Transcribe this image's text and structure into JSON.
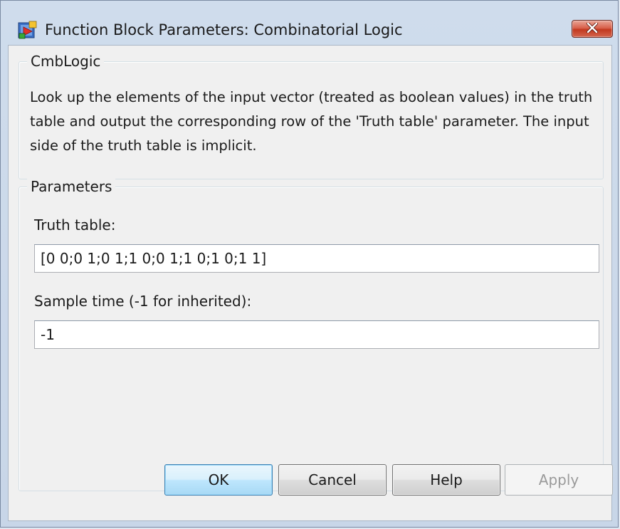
{
  "window": {
    "title": "Function Block Parameters: Combinatorial Logic",
    "close_icon": "close-icon",
    "app_icon": "simulink-block-icon"
  },
  "description_group": {
    "label": "CmbLogic",
    "text": "Look up the elements of the input vector (treated as boolean values) in the truth table and output the corresponding row of the 'Truth table' parameter.  The input side of the truth table is implicit."
  },
  "parameters_group": {
    "label": "Parameters",
    "truth_table": {
      "label": "Truth table:",
      "value": "[0 0;0 1;0 1;1 0;0 1;1 0;1 0;1 1]"
    },
    "sample_time": {
      "label": "Sample time (-1 for inherited):",
      "value": "-1"
    }
  },
  "buttons": {
    "ok": "OK",
    "cancel": "Cancel",
    "help": "Help",
    "apply": "Apply"
  },
  "colors": {
    "close_button": "#c2391f",
    "default_button": "#bee6fd",
    "dialog_background": "#f0f0f0"
  }
}
